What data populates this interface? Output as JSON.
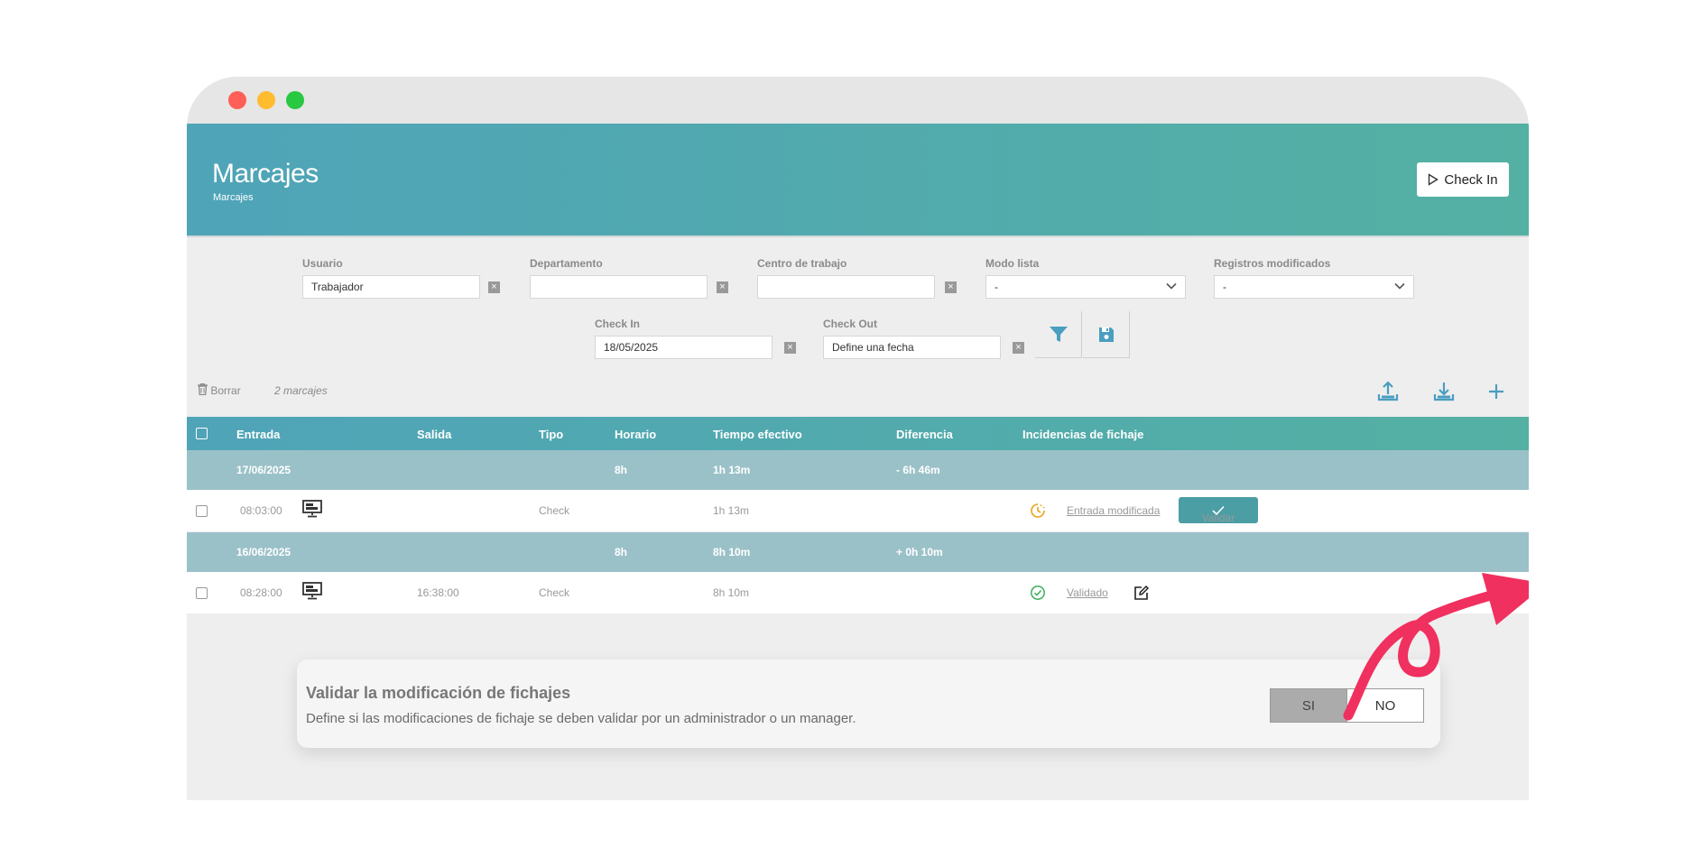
{
  "header": {
    "title": "Marcajes",
    "subtitle": "Marcajes",
    "checkin_label": "Check In"
  },
  "filters": {
    "usuario": {
      "label": "Usuario",
      "value": "Trabajador"
    },
    "departamento": {
      "label": "Departamento",
      "value": ""
    },
    "centro": {
      "label": "Centro de trabajo",
      "value": ""
    },
    "modo_lista": {
      "label": "Modo lista",
      "value": "-"
    },
    "registros": {
      "label": "Registros modificados",
      "value": "-"
    },
    "check_in": {
      "label": "Check In",
      "value": "18/05/2025"
    },
    "check_out": {
      "label": "Check Out",
      "value": "Define una fecha"
    },
    "clear_glyph": "×"
  },
  "toolbar": {
    "delete_label": "Borrar",
    "count": "2 marcajes"
  },
  "table": {
    "columns": [
      "Entrada",
      "Salida",
      "Tipo",
      "Horario",
      "Tiempo efectivo",
      "Diferencia",
      "Incidencias de fichaje"
    ],
    "groups": [
      {
        "date": "17/06/2025",
        "horario": "8h",
        "tiempo": "1h 13m",
        "diferencia": "- 6h 46m"
      },
      {
        "date": "16/06/2025",
        "horario": "8h",
        "tiempo": "8h 10m",
        "diferencia": "+ 0h 10m"
      }
    ],
    "rows": [
      {
        "entrada": "08:03:00",
        "salida": "",
        "tipo": "Check",
        "tiempo": "1h 13m",
        "incidencia": "Entrada modificada",
        "action": "Validar"
      },
      {
        "entrada": "08:28:00",
        "salida": "16:38:00",
        "tipo": "Check",
        "tiempo": "8h 10m",
        "incidencia": "Validado"
      }
    ]
  },
  "panel": {
    "title": "Validar la modificación de fichajes",
    "description": "Define si las modificaciones de fichaje se deben validar por un administrador o un manager.",
    "yes": "SI",
    "no": "NO"
  },
  "colors": {
    "accent": "#4fa4b8",
    "accent2": "#54b0a3",
    "group": "#9bc1c8",
    "arrow": "#f0305e",
    "clock": "#e8a317",
    "check": "#3fae5a"
  }
}
